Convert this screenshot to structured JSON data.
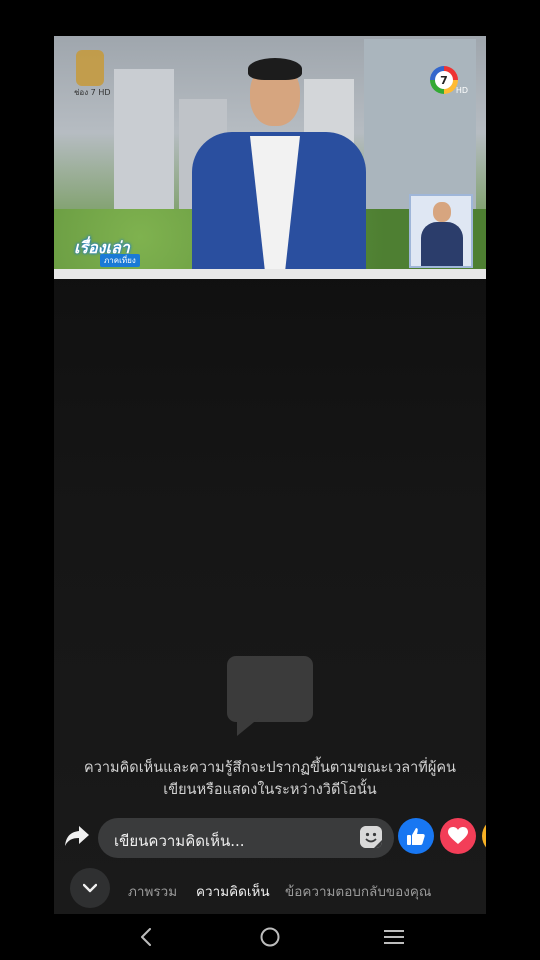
{
  "video": {
    "channel_badge": "7",
    "channel_hd": "HD",
    "left_logo_text": "ช่อง 7 HD",
    "show_logo": "เรื่องเล่า",
    "show_logo_sub": "ภาคเที่ยง"
  },
  "comments_empty": {
    "icon": "speech-bubble-icon",
    "text_line1": "ความคิดเห็นและความรู้สึกจะปรากฏขึ้นตามขณะเวลาที่ผู้คน",
    "text_line2": "เขียนหรือแสดงในระหว่างวิดีโอนั้น"
  },
  "composer": {
    "share_icon": "share-arrow-icon",
    "placeholder": "เขียนความคิดเห็น...",
    "sticker_icon": "sticker-icon"
  },
  "reactions": [
    {
      "name": "like",
      "icon": "thumbs-up-icon",
      "color": "#1877f2"
    },
    {
      "name": "love",
      "icon": "heart-icon",
      "color": "#f33e58"
    },
    {
      "name": "haha",
      "icon": "haha-emoji-icon",
      "color": "#f7b125"
    }
  ],
  "tabs": {
    "overview": "ภาพรวม",
    "comments": "ความคิดเห็น",
    "your_responses": "ข้อความตอบกลับของคุณ",
    "active": "comments"
  },
  "system_nav": {
    "back": "back-icon",
    "home": "home-icon",
    "recents": "menu-icon"
  }
}
